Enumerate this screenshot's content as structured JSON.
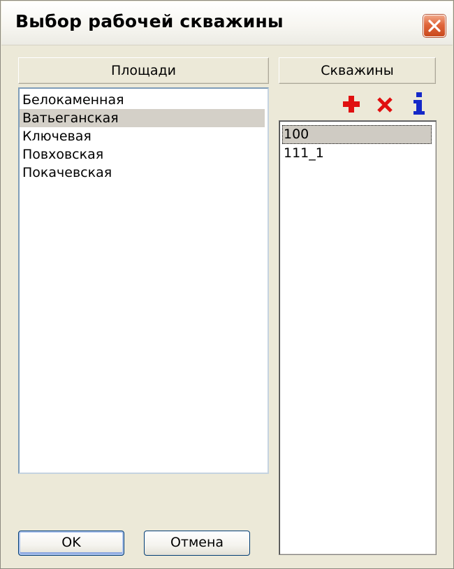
{
  "window": {
    "title": "Выбор рабочей скважины"
  },
  "areas_panel": {
    "header": "Площади",
    "items": [
      {
        "label": "Белокаменная",
        "selected": false
      },
      {
        "label": "Ватьеганская",
        "selected": true
      },
      {
        "label": "Ключевая",
        "selected": false
      },
      {
        "label": "Повховская",
        "selected": false
      },
      {
        "label": "Покачевская",
        "selected": false
      }
    ]
  },
  "wells_panel": {
    "header": "Скважины",
    "toolbar": {
      "add_icon": "plus-icon",
      "delete_icon": "cross-icon",
      "info_icon": "info-icon",
      "add_color": "#e01010",
      "delete_color": "#e01010",
      "info_color": "#1428c8"
    },
    "items": [
      {
        "label": "100",
        "selected": true
      },
      {
        "label": "111_1",
        "selected": false
      }
    ]
  },
  "buttons": {
    "ok_label": "OK",
    "cancel_label": "Отмена"
  }
}
